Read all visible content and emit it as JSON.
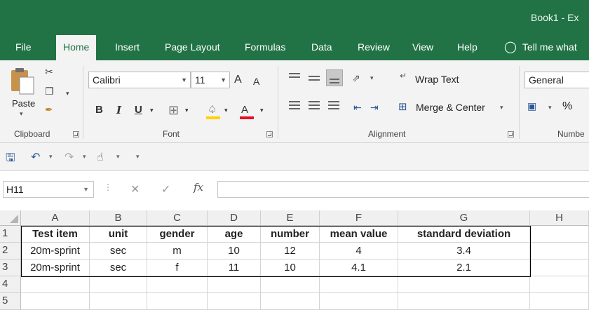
{
  "window": {
    "title": "Book1  -  Ex"
  },
  "tabs": [
    {
      "label": "File"
    },
    {
      "label": "Home"
    },
    {
      "label": "Insert"
    },
    {
      "label": "Page Layout"
    },
    {
      "label": "Formulas"
    },
    {
      "label": "Data"
    },
    {
      "label": "Review"
    },
    {
      "label": "View"
    },
    {
      "label": "Help"
    },
    {
      "label": "Tell me what"
    }
  ],
  "ribbon": {
    "clipboard": {
      "paste_label": "Paste",
      "group_label": "Clipboard"
    },
    "font": {
      "font_name": "Calibri",
      "font_size": "11",
      "group_label": "Font",
      "bold": "B",
      "italic": "I",
      "underline": "U",
      "grow": "A",
      "shrink": "A",
      "font_color": "A"
    },
    "alignment": {
      "wrap_text": "Wrap Text",
      "merge_center": "Merge & Center",
      "group_label": "Alignment"
    },
    "number": {
      "format": "General",
      "percent": "%",
      "group_label": "Numbe"
    }
  },
  "formula_bar": {
    "name_box": "H11",
    "fx": "fx",
    "value": ""
  },
  "sheet": {
    "columns": [
      "A",
      "B",
      "C",
      "D",
      "E",
      "F",
      "G",
      "H"
    ],
    "rows": [
      "1",
      "2",
      "3",
      "4",
      "5"
    ],
    "cells": [
      [
        "Test item",
        "unit",
        "gender",
        "age",
        "number",
        "mean value",
        "standard deviation",
        ""
      ],
      [
        "20m-sprint",
        "sec",
        "m",
        "10",
        "12",
        "4",
        "3.4",
        ""
      ],
      [
        "20m-sprint",
        "sec",
        "f",
        "11",
        "10",
        "4.1",
        "2.1",
        ""
      ],
      [
        "",
        "",
        "",
        "",
        "",
        "",
        "",
        ""
      ],
      [
        "",
        "",
        "",
        "",
        "",
        "",
        "",
        ""
      ]
    ]
  },
  "colors": {
    "brand": "#217346",
    "ribbon": "#f3f3f3",
    "font_color_bar": "#e81123",
    "fill_bar": "#ffd200"
  }
}
